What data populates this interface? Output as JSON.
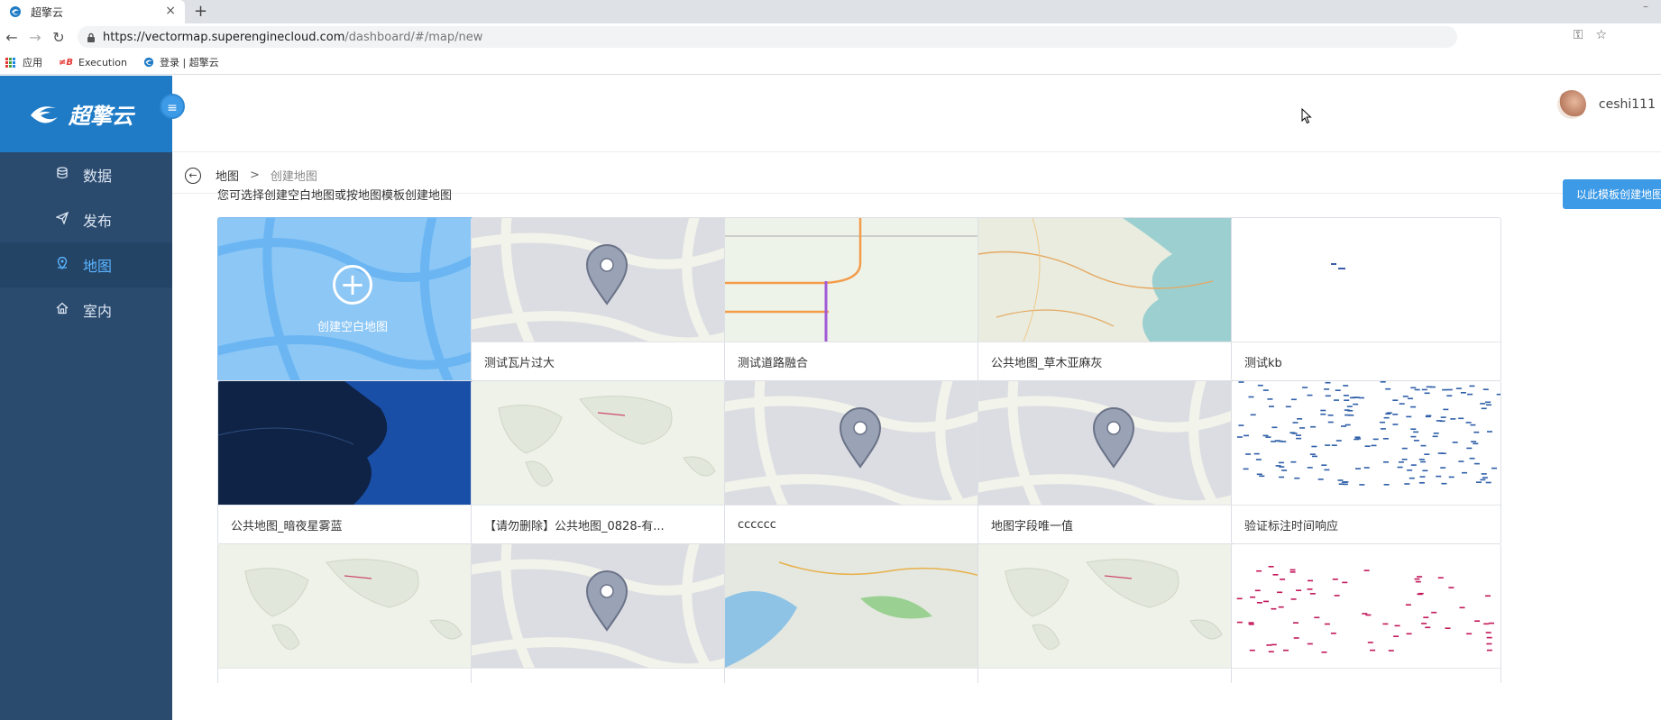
{
  "browser": {
    "tab_title": "超擎云",
    "close": "×",
    "new_tab": "+",
    "url_host": "https://vectormap.superenginecloud.com",
    "url_path": "/dashboard/#/map/new",
    "bookmarks": [
      {
        "label": "应用"
      },
      {
        "label": "Execution",
        "icon": "execution-icon"
      },
      {
        "label": "登录 | 超擎云"
      }
    ],
    "ext_label": "aB"
  },
  "app": {
    "logo_text": "超擎云",
    "menu_toggle": "≡",
    "nav": [
      {
        "label": "数据",
        "icon": "database-icon",
        "active": false
      },
      {
        "label": "发布",
        "icon": "send-icon",
        "active": false
      },
      {
        "label": "地图",
        "icon": "map-pin-icon",
        "active": true
      },
      {
        "label": "室内",
        "icon": "home-icon",
        "active": false
      }
    ],
    "user_name": "ceshi111",
    "breadcrumb": {
      "back": "←",
      "parent": "地图",
      "sep": ">",
      "current": "创建地图"
    },
    "hint": "您可选择创建空白地图或按地图模板创建地图",
    "template_button": "以此模板创建地图",
    "create_card_label": "创建空白地图",
    "create_plus": "+",
    "cards": [
      {
        "label": "测试瓦片过大",
        "thumb": "placeholder"
      },
      {
        "label": "测试道路融合",
        "thumb": "roads"
      },
      {
        "label": "公共地图_草木亚麻灰",
        "thumb": "terrain"
      },
      {
        "label": "测试kb",
        "thumb": "sparse"
      },
      {
        "label": "公共地图_暗夜星雾蓝",
        "thumb": "dark"
      },
      {
        "label": "【请勿删除】公共地图_0828-有...",
        "thumb": "world"
      },
      {
        "label": "cccccc",
        "thumb": "placeholder"
      },
      {
        "label": "地图字段唯一值",
        "thumb": "placeholder"
      },
      {
        "label": "验证标注时间响应",
        "thumb": "dots-blue"
      },
      {
        "label": "",
        "thumb": "world"
      },
      {
        "label": "",
        "thumb": "placeholder"
      },
      {
        "label": "",
        "thumb": "satellite"
      },
      {
        "label": "",
        "thumb": "world"
      },
      {
        "label": "",
        "thumb": "dots-red"
      }
    ],
    "colors": {
      "sidebar": "#2a4a6e",
      "accent": "#3c9ae6",
      "active_text": "#5bb4ff"
    }
  }
}
